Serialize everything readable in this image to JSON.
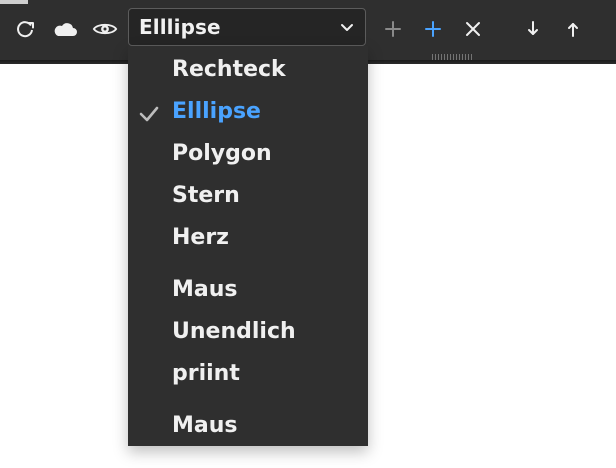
{
  "toolbar": {
    "select": {
      "value": "Elllipse"
    },
    "icons": [
      {
        "name": "refresh-icon"
      },
      {
        "name": "cloud-icon"
      },
      {
        "name": "eye-icon"
      },
      {
        "name": "plus-icon"
      },
      {
        "name": "plus-blue-icon"
      },
      {
        "name": "close-icon"
      },
      {
        "name": "arrow-down-icon"
      },
      {
        "name": "arrow-up-icon"
      }
    ],
    "colors": {
      "background": "#2f2f2f",
      "accent": "#4aa3ff",
      "text": "#f0f0f0"
    }
  },
  "menu": {
    "items": [
      {
        "label": "Rechteck",
        "selected": false
      },
      {
        "label": "Elllipse",
        "selected": true
      },
      {
        "label": "Polygon",
        "selected": false
      },
      {
        "label": "Stern",
        "selected": false
      },
      {
        "label": "Herz",
        "selected": false
      },
      {
        "label": "Maus",
        "selected": false
      },
      {
        "label": "Unendlich",
        "selected": false
      },
      {
        "label": "priint",
        "selected": false
      },
      {
        "label": "Maus",
        "selected": false
      }
    ]
  }
}
